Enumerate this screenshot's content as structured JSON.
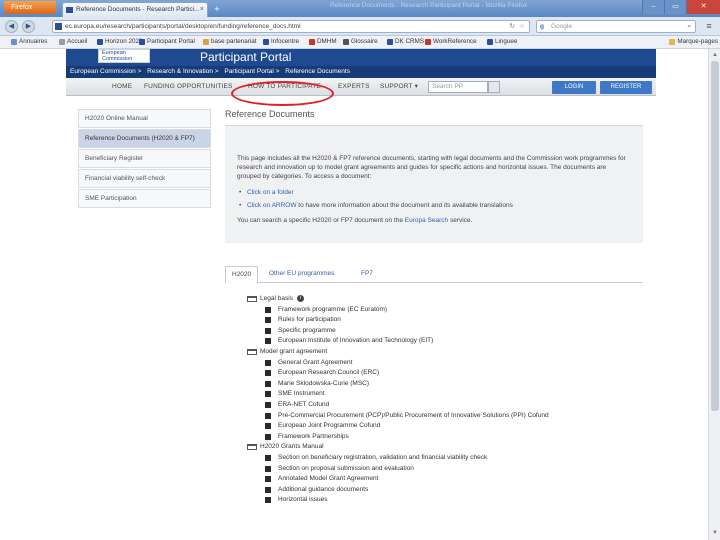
{
  "browser": {
    "menu_button": "Firefox",
    "tab_title": "Reference Documents - Research Partici...",
    "tab_close": "×",
    "new_tab": "+",
    "ghost_title": "Reference Documents - Research Participant Portal - Mozilla Firefox",
    "win_min": "–",
    "win_max": "▭",
    "win_close": "✕",
    "back": "◀",
    "forward": "▶",
    "url": "ec.europa.eu/research/participants/portal/desktop/en/funding/reference_docs.html",
    "url_star": "☆",
    "url_reload": "↻",
    "search_placeholder": "Google",
    "search_engine_letter": "g",
    "menu_icon": "≡",
    "bookmarks": [
      "Annuaires",
      "Accueil",
      "Horizon 2020",
      "Participant Portal",
      "base partenariat",
      "Infocentre",
      "DMHM",
      "Glossaire",
      "DK CRMS",
      "WorkReference",
      "Linguee"
    ],
    "bookmarks_right": "Marque-pages",
    "accent": "#5b87c2"
  },
  "portal": {
    "logo_line1": "European",
    "logo_line2": "Commission",
    "title": "Participant Portal",
    "breadcrumb": [
      "European Commission >",
      "Research & Innovation >",
      "Participant Portal >",
      "Reference Documents"
    ],
    "nav": {
      "home": "HOME",
      "funding": "FUNDING OPPORTUNITIES",
      "how_to": "HOW TO PARTICIPATE",
      "experts": "EXPERTS",
      "support": "SUPPORT ▾",
      "search_placeholder": "Search PP",
      "login": "LOGIN",
      "register": "REGISTER"
    },
    "header_color": "#1f4a8f",
    "highlight_color": "#e01f26"
  },
  "sidebar": {
    "items": [
      {
        "label": "H2020 Online Manual"
      },
      {
        "label": "Reference Documents (H2020 & FP7)"
      },
      {
        "label": "Beneficiary Register"
      },
      {
        "label": "Financial viability self-check"
      },
      {
        "label": "SME Participation"
      }
    ]
  },
  "content": {
    "title": "Reference Documents",
    "intro": "This page includes all the H2020 & FP7 reference documents, starting with legal documents and the Commission work programmes for research and innovation up to model grant agreements and guides for specific actions and horizontal issues. The documents are grouped by categories. To access a document:",
    "bullet1_link": "Click on a folder",
    "bullet2_link": "Click on ARROW",
    "bullet2_rest": " to have more information about the document and its available translations",
    "search_prefix": "You can search a specific H2020 or FP7 document on the ",
    "search_link": "Europa Search",
    "search_suffix": " service."
  },
  "tabs": [
    {
      "label": "H2020"
    },
    {
      "label": "Other EU programmes"
    },
    {
      "label": "FP7"
    }
  ],
  "tree": [
    {
      "kind": "folder",
      "label": "Legal basis",
      "info": "i"
    },
    {
      "kind": "doc",
      "label": "Framework programme (EC Euratom)"
    },
    {
      "kind": "doc",
      "label": "Rules for participation"
    },
    {
      "kind": "doc",
      "label": "Specific programme"
    },
    {
      "kind": "doc",
      "label": "European Institute of Innovation and Technology (EIT)"
    },
    {
      "kind": "folder",
      "label": "Model grant agreement"
    },
    {
      "kind": "doc",
      "label": "General Grant Agreement"
    },
    {
      "kind": "doc",
      "label": "European Research Council (ERC)"
    },
    {
      "kind": "doc",
      "label": "Marie Sklodowska-Curie (MSC)"
    },
    {
      "kind": "doc",
      "label": "SME Instrument"
    },
    {
      "kind": "doc",
      "label": "ERA-NET Cofund"
    },
    {
      "kind": "doc",
      "label": "Pre-Commercial Procurement (PCP)/Public Procurement of Innovative Solutions (PPI) Cofund"
    },
    {
      "kind": "doc",
      "label": "European Joint Programme Cofund"
    },
    {
      "kind": "doc",
      "label": "Framework Partnerships"
    },
    {
      "kind": "folder",
      "label": "H2020 Grants Manual"
    },
    {
      "kind": "doc",
      "label": "Section on beneficiary registration, validation and financial viability check"
    },
    {
      "kind": "doc",
      "label": "Section on proposal submission and evaluation"
    },
    {
      "kind": "doc",
      "label": "Annotated Model Grant Agreement"
    },
    {
      "kind": "doc",
      "label": "Additional guidance documents"
    },
    {
      "kind": "doc",
      "label": "Horizontal issues"
    }
  ]
}
